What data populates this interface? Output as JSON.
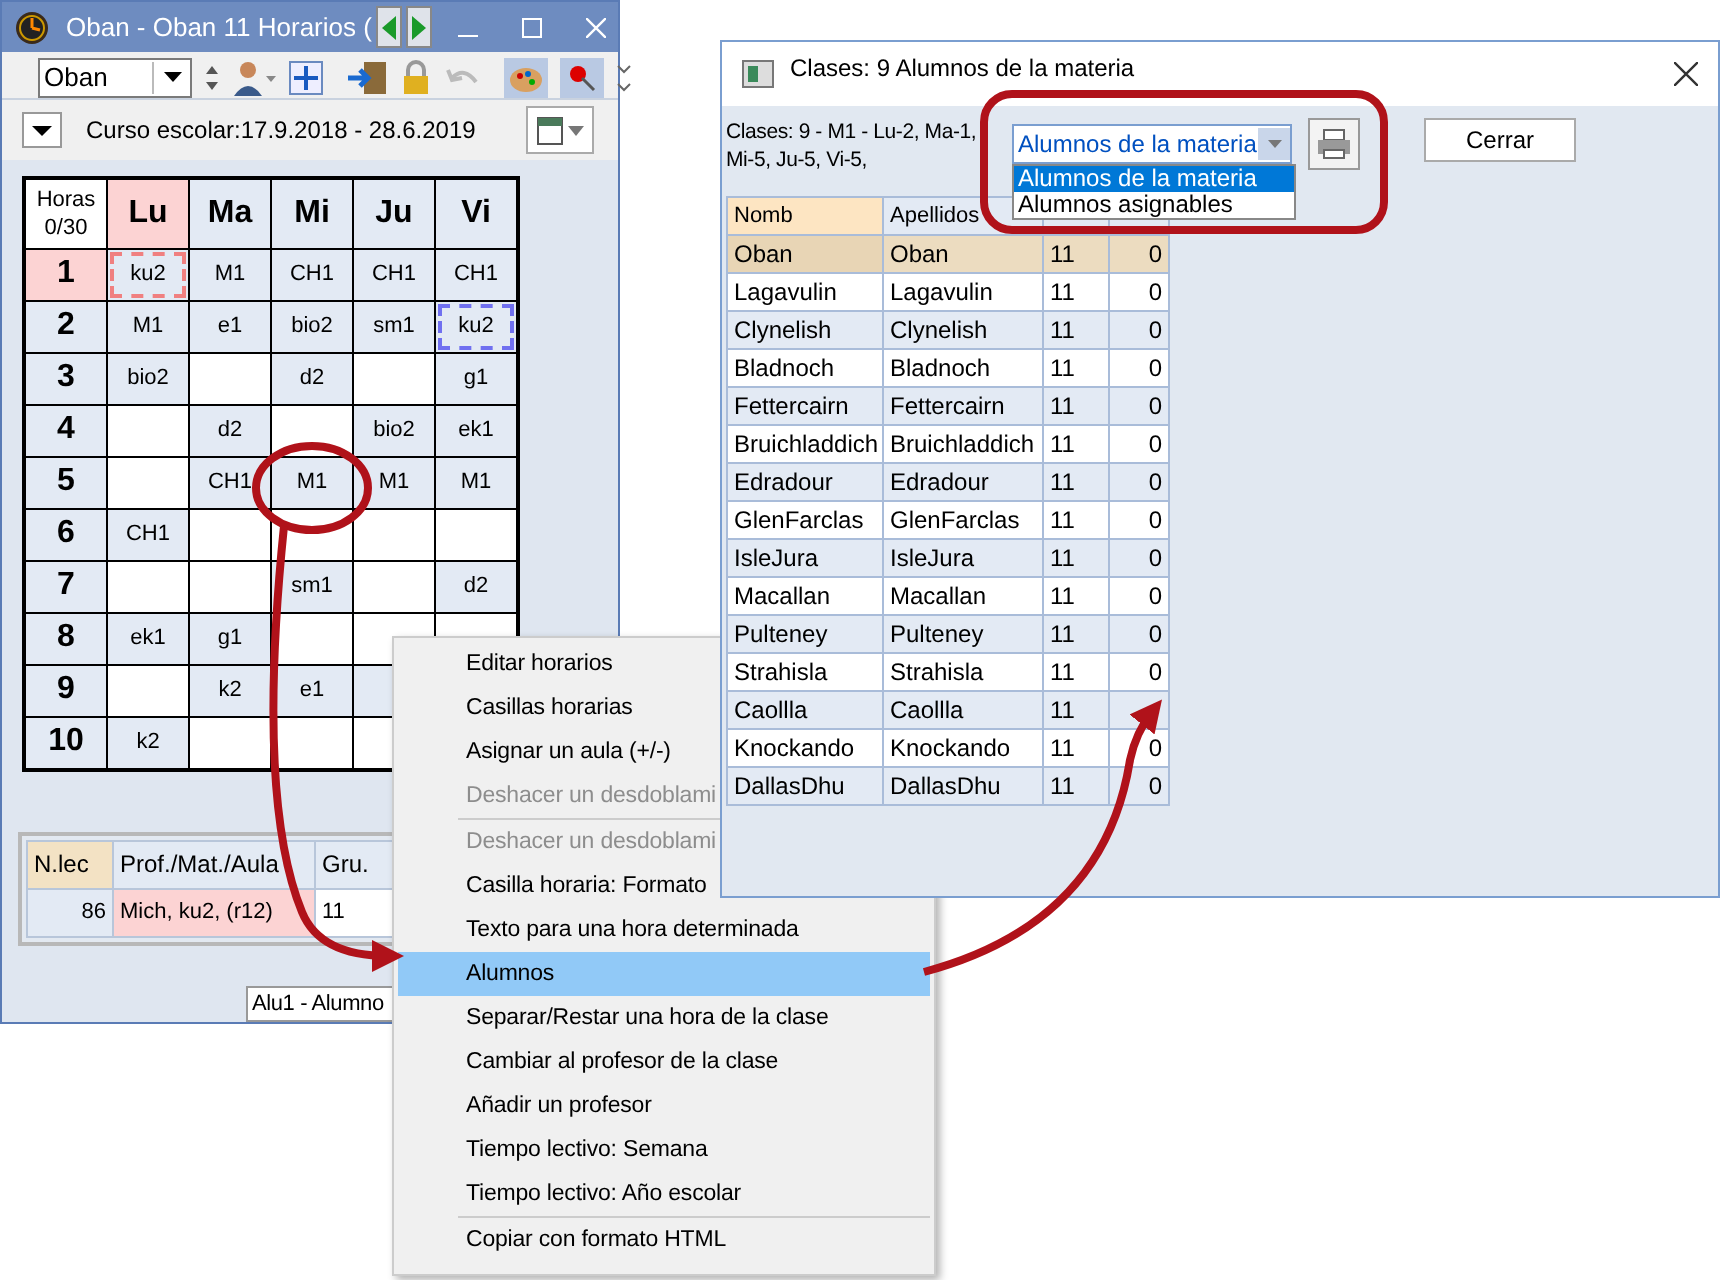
{
  "left_window": {
    "title": "Oban - Oban 11  Horarios  (",
    "class_select": "Oban",
    "school_year": "Curso escolar:17.9.2018 - 28.6.2019",
    "timetable": {
      "corner_line_1": "Horas",
      "corner_line_2": "0/30",
      "days": [
        {
          "label": "Lu",
          "selected": true
        },
        {
          "label": "Ma",
          "selected": false
        },
        {
          "label": "Mi",
          "selected": false
        },
        {
          "label": "Ju",
          "selected": false
        },
        {
          "label": "Vi",
          "selected": false
        }
      ],
      "rows": [
        {
          "hour": "1",
          "selected": true,
          "cells": [
            {
              "kind": "lesson",
              "text": "ku2",
              "color": "#f08080"
            },
            {
              "kind": "lesson",
              "text": "M1"
            },
            {
              "kind": "lesson",
              "text": "CH1"
            },
            {
              "kind": "lesson",
              "text": "CH1"
            },
            {
              "kind": "lesson",
              "text": "CH1"
            }
          ]
        },
        {
          "hour": "2",
          "selected": false,
          "cells": [
            {
              "kind": "lesson",
              "text": "M1"
            },
            {
              "kind": "lesson",
              "text": "e1"
            },
            {
              "kind": "lesson",
              "text": "bio2"
            },
            {
              "kind": "lesson",
              "text": "sm1"
            },
            {
              "kind": "lesson",
              "text": "ku2",
              "color": "#7070f0"
            }
          ]
        },
        {
          "hour": "3",
          "selected": false,
          "cells": [
            {
              "kind": "lesson",
              "text": "bio2"
            },
            {
              "kind": "empty"
            },
            {
              "kind": "lesson",
              "text": "d2"
            },
            {
              "kind": "empty"
            },
            {
              "kind": "lesson",
              "text": "g1"
            }
          ]
        },
        {
          "hour": "4",
          "selected": false,
          "cells": [
            {
              "kind": "empty"
            },
            {
              "kind": "lesson",
              "text": "d2"
            },
            {
              "kind": "empty"
            },
            {
              "kind": "lesson",
              "text": "bio2"
            },
            {
              "kind": "lesson",
              "text": "ek1"
            }
          ]
        },
        {
          "hour": "5",
          "selected": false,
          "cells": [
            {
              "kind": "empty"
            },
            {
              "kind": "lesson",
              "text": "CH1"
            },
            {
              "kind": "lesson",
              "text": "M1"
            },
            {
              "kind": "lesson",
              "text": "M1"
            },
            {
              "kind": "lesson",
              "text": "M1"
            }
          ]
        },
        {
          "hour": "6",
          "selected": false,
          "cells": [
            {
              "kind": "lesson",
              "text": "CH1"
            },
            {
              "kind": "empty"
            },
            {
              "kind": "empty"
            },
            {
              "kind": "empty"
            },
            {
              "kind": "empty"
            }
          ]
        },
        {
          "hour": "7",
          "selected": false,
          "cells": [
            {
              "kind": "empty"
            },
            {
              "kind": "empty"
            },
            {
              "kind": "lesson",
              "text": "sm1"
            },
            {
              "kind": "empty"
            },
            {
              "kind": "lesson",
              "text": "d2"
            }
          ]
        },
        {
          "hour": "8",
          "selected": false,
          "cells": [
            {
              "kind": "lesson",
              "text": "ek1"
            },
            {
              "kind": "lesson",
              "text": "g1"
            },
            {
              "kind": "empty"
            },
            {
              "kind": "empty"
            },
            {
              "kind": "empty"
            }
          ]
        },
        {
          "hour": "9",
          "selected": false,
          "cells": [
            {
              "kind": "empty"
            },
            {
              "kind": "lesson",
              "text": "k2"
            },
            {
              "kind": "lesson",
              "text": "e1"
            },
            {
              "kind": "lesson"
            },
            {
              "kind": "covered"
            }
          ]
        },
        {
          "hour": "10",
          "selected": false,
          "cells": [
            {
              "kind": "lesson",
              "text": "k2"
            },
            {
              "kind": "empty"
            },
            {
              "kind": "empty"
            },
            {
              "kind": "empty"
            },
            {
              "kind": "covered"
            }
          ]
        }
      ]
    },
    "lessons": {
      "columns": [
        "N.lec",
        "Prof./Mat./Aula",
        "Gru."
      ],
      "rows": [
        {
          "number": "86",
          "text": "Mich, ku2, (r12)",
          "group": "11"
        }
      ]
    },
    "student_select": "Alu1 - Alumno"
  },
  "right_window": {
    "title": "Clases: 9 Alumnos de la materia",
    "info_line_1": "Clases: 9 - M1 - Lu-2, Ma-1,",
    "info_line_2": "Mi-5, Ju-5, Vi-5,",
    "list_select": "Alumnos de la materia",
    "options": [
      {
        "label": "Alumnos de la materia",
        "selected": true
      },
      {
        "label": "Alumnos asignables",
        "selected": false
      }
    ],
    "close_button": "Cerrar",
    "columns": [
      "Nomb",
      "Apellidos"
    ],
    "rows": [
      {
        "first": "Oban",
        "last": "Oban",
        "group": "11",
        "pin": "0",
        "selected": true
      },
      {
        "first": "Lagavulin",
        "last": "Lagavulin",
        "group": "11",
        "pin": "0",
        "selected": false
      },
      {
        "first": "Clynelish",
        "last": "Clynelish",
        "group": "11",
        "pin": "0",
        "selected": false
      },
      {
        "first": "Bladnoch",
        "last": "Bladnoch",
        "group": "11",
        "pin": "0",
        "selected": false
      },
      {
        "first": "Fettercairn",
        "last": "Fettercairn",
        "group": "11",
        "pin": "0",
        "selected": false
      },
      {
        "first": "Bruichladdich",
        "last": "Bruichladdich",
        "group": "11",
        "pin": "0",
        "selected": false
      },
      {
        "first": "Edradour",
        "last": "Edradour",
        "group": "11",
        "pin": "0",
        "selected": false
      },
      {
        "first": "GlenFarclas",
        "last": "GlenFarclas",
        "group": "11",
        "pin": "0",
        "selected": false
      },
      {
        "first": "IsleJura",
        "last": "IsleJura",
        "group": "11",
        "pin": "0",
        "selected": false
      },
      {
        "first": "Macallan",
        "last": "Macallan",
        "group": "11",
        "pin": "0",
        "selected": false
      },
      {
        "first": "Pulteney",
        "last": "Pulteney",
        "group": "11",
        "pin": "0",
        "selected": false
      },
      {
        "first": "Strahisla",
        "last": "Strahisla",
        "group": "11",
        "pin": "0",
        "selected": false
      },
      {
        "first": "Caollla",
        "last": "Caollla",
        "group": "11",
        "selected": false
      },
      {
        "first": "Knockando",
        "last": "Knockando",
        "group": "11",
        "pin": "0",
        "selected": false
      },
      {
        "first": "DallasDhu",
        "last": "DallasDhu",
        "group": "11",
        "pin": "0",
        "selected": false
      }
    ]
  },
  "context_menu": [
    {
      "kind": "item",
      "label": "Editar horarios",
      "disabled": false,
      "selected": false
    },
    {
      "kind": "item",
      "label": "Casillas horarias",
      "disabled": false,
      "selected": false
    },
    {
      "kind": "item",
      "label": "Asignar un aula (+/-)",
      "disabled": false,
      "selected": false
    },
    {
      "kind": "item",
      "label": "Deshacer un desdoblami",
      "disabled": true,
      "selected": false
    },
    {
      "kind": "separator"
    },
    {
      "kind": "item",
      "label": "Deshacer un desdoblami",
      "disabled": true,
      "selected": false
    },
    {
      "kind": "item",
      "label": "Casilla horaria: Formato",
      "disabled": false,
      "selected": false
    },
    {
      "kind": "item",
      "label": "Texto para una hora determinada",
      "disabled": false,
      "selected": false
    },
    {
      "kind": "item",
      "label": "Alumnos",
      "disabled": false,
      "selected": true
    },
    {
      "kind": "item",
      "label": "Separar/Restar una hora de la clase",
      "disabled": false,
      "selected": false
    },
    {
      "kind": "item",
      "label": "Cambiar al profesor de la clase",
      "disabled": false,
      "selected": false
    },
    {
      "kind": "item",
      "label": "Añadir un profesor",
      "disabled": false,
      "selected": false
    },
    {
      "kind": "item",
      "label": "Tiempo lectivo: Semana",
      "disabled": false,
      "selected": false
    },
    {
      "kind": "item",
      "label": "Tiempo lectivo: Año escolar",
      "disabled": false,
      "selected": false
    },
    {
      "kind": "separator"
    },
    {
      "kind": "item",
      "label": "Copiar con formato HTML",
      "disabled": false,
      "selected": false
    }
  ]
}
